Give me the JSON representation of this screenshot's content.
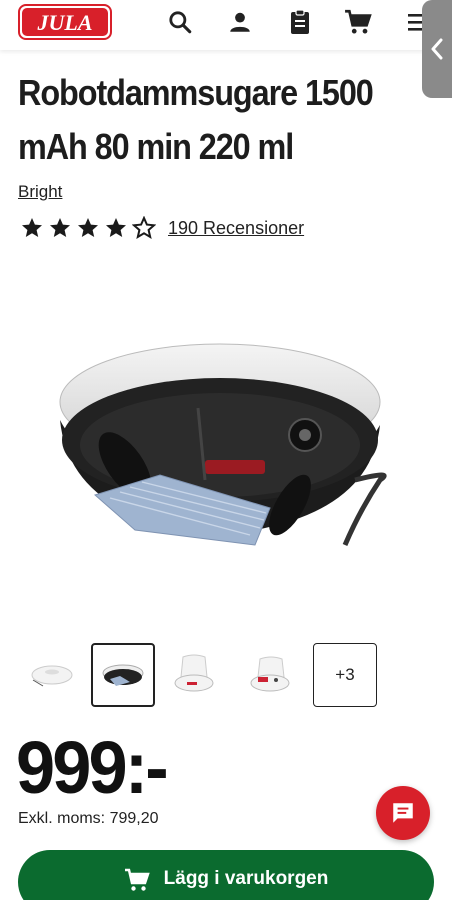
{
  "header": {
    "logo_text": "JULA",
    "icons": [
      "search-icon",
      "user-icon",
      "clipboard-icon",
      "cart-icon",
      "menu-icon"
    ]
  },
  "side_tab": {
    "icon": "chevron-left-icon"
  },
  "product": {
    "title": "Robotdammsugare 1500 mAh 80 min 220 ml",
    "brand": "Bright",
    "rating": 4,
    "rating_max": 5,
    "reviews_label": "190 Recensioner"
  },
  "gallery": {
    "thumbnails": [
      "robot-top-view",
      "robot-bottom-view",
      "robot-station-view",
      "robot-station-alt-view"
    ],
    "more_label": "+3",
    "selected_index": 1
  },
  "pricing": {
    "price": "999:-",
    "excl_vat_label": "Exkl. moms: 799,20"
  },
  "cta": {
    "add_to_cart_label": "Lägg i varukorgen"
  },
  "colors": {
    "brand_red": "#d8202a",
    "cta_green": "#0b6b2f"
  }
}
